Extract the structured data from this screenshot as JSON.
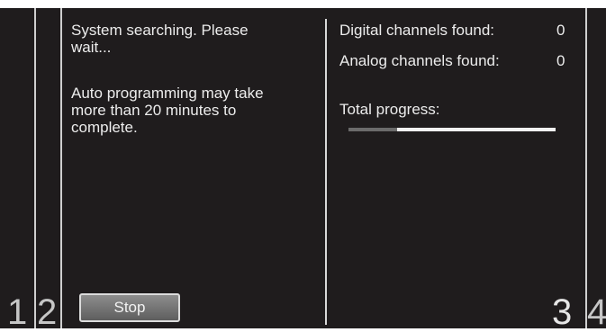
{
  "dialog": {
    "status_message": "System searching. Please\nwait...",
    "info_message": "Auto programming may take\nmore than 20 minutes to\ncomplete.",
    "stop_label": "Stop"
  },
  "stats": {
    "digital_label": "Digital channels found:",
    "digital_value": "0",
    "analog_label": "Analog channels found:",
    "analog_value": "0",
    "progress_label": "Total progress:",
    "progress_fraction": 0.77
  },
  "callouts": {
    "one": "1",
    "two": "2",
    "three": "3",
    "four": "4"
  }
}
